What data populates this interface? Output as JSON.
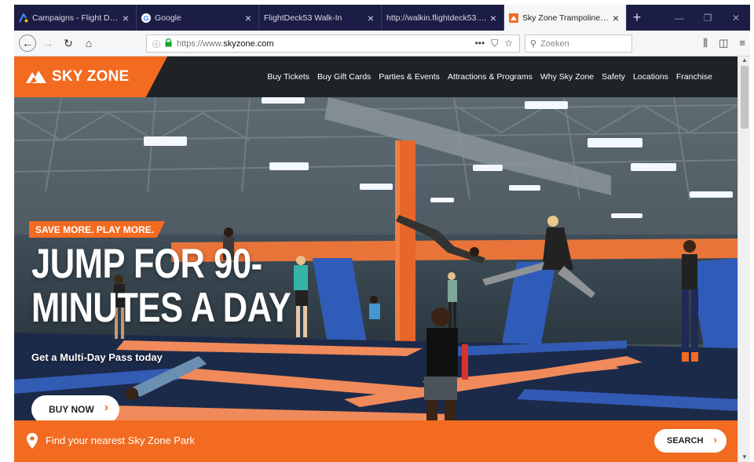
{
  "browser": {
    "tabs": [
      {
        "label": "Campaigns - Flight Deck 53",
        "favicon": "ads-icon",
        "active": false
      },
      {
        "label": "Google",
        "favicon": "google-icon",
        "active": false
      },
      {
        "label": "FlightDeck53 Walk-In",
        "favicon": "",
        "active": false
      },
      {
        "label": "http://walkin.flightdeck53.com/w",
        "favicon": "",
        "active": false
      },
      {
        "label": "Sky Zone Trampoline Park | Jump",
        "favicon": "skyzone-icon",
        "active": true
      }
    ],
    "new_tab": "+",
    "url": {
      "protocol": "https://www.",
      "domain": "skyzone.com",
      "ellipsis": "•••"
    },
    "search_placeholder": "Zoeken"
  },
  "site": {
    "logo_text": "SKY ZONE",
    "nav": [
      "Buy Tickets",
      "Buy Gift Cards",
      "Parties & Events",
      "Attractions & Programs",
      "Why Sky Zone",
      "Safety",
      "Locations",
      "Franchise"
    ],
    "promo": "SAVE MORE. PLAY MORE.",
    "headline_line1": "JUMP FOR 90-",
    "headline_line2": "MINUTES A DAY",
    "subline": "Get a Multi-Day Pass today",
    "buy_now": "BUY NOW",
    "find_text": "Find your nearest Sky Zone Park",
    "search_button": "SEARCH"
  },
  "colors": {
    "brand_orange": "#f26b21",
    "nav_dark": "#1f2227",
    "tab_strip": "#1c1d45"
  }
}
